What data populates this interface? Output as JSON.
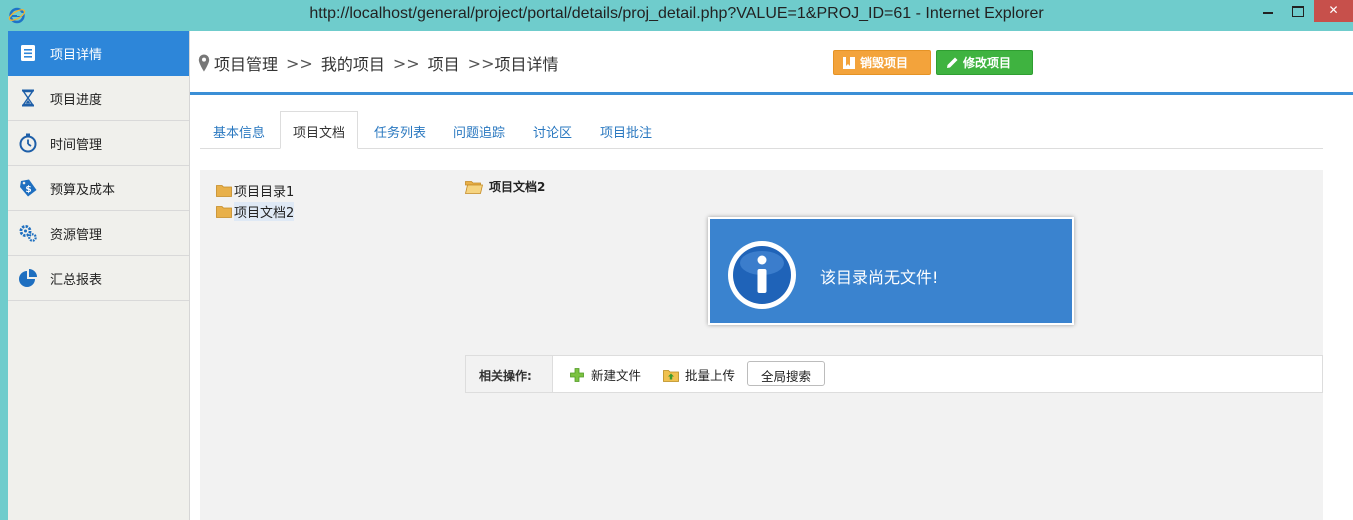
{
  "window": {
    "title": "http://localhost/general/project/portal/details/proj_detail.php?VALUE=1&PROJ_ID=61 - Internet Explorer",
    "icon": "ie-icon"
  },
  "sidebar": {
    "items": [
      {
        "label": "项目详情",
        "icon": "document-list-icon",
        "active": true
      },
      {
        "label": "项目进度",
        "icon": "hourglass-icon",
        "active": false
      },
      {
        "label": "时间管理",
        "icon": "stopwatch-icon",
        "active": false
      },
      {
        "label": "预算及成本",
        "icon": "money-tag-icon",
        "active": false
      },
      {
        "label": "资源管理",
        "icon": "gears-icon",
        "active": false
      },
      {
        "label": "汇总报表",
        "icon": "pie-chart-icon",
        "active": false
      }
    ]
  },
  "header": {
    "breadcrumb": {
      "items": [
        "项目管理",
        "我的项目",
        "项目",
        "项目详情"
      ],
      "separator": ">>"
    },
    "buttons": {
      "close_project": "销毁项目",
      "edit_project": "修改项目"
    }
  },
  "tabs": [
    {
      "label": "基本信息",
      "active": false
    },
    {
      "label": "项目文档",
      "active": true
    },
    {
      "label": "任务列表",
      "active": false
    },
    {
      "label": "问题追踪",
      "active": false
    },
    {
      "label": "讨论区",
      "active": false
    },
    {
      "label": "项目批注",
      "active": false
    }
  ],
  "tree": {
    "nodes": [
      {
        "label": "项目目录1",
        "selected": false
      },
      {
        "label": "项目文档2",
        "selected": true
      }
    ]
  },
  "content": {
    "current_folder": "项目文档2",
    "message": "该目录尚无文件!"
  },
  "operations": {
    "label": "相关操作:",
    "new_file": "新建文件",
    "batch_upload": "批量上传",
    "global_search": "全局搜索"
  },
  "colors": {
    "titlebar": "#6fcccc",
    "sidebar_active": "#2d86d9",
    "header_rule": "#3b8fd6",
    "button_orange": "#f3a33b",
    "button_green": "#3fb340",
    "message_box": "#3a83cf",
    "tab_link": "#2a78c0"
  }
}
